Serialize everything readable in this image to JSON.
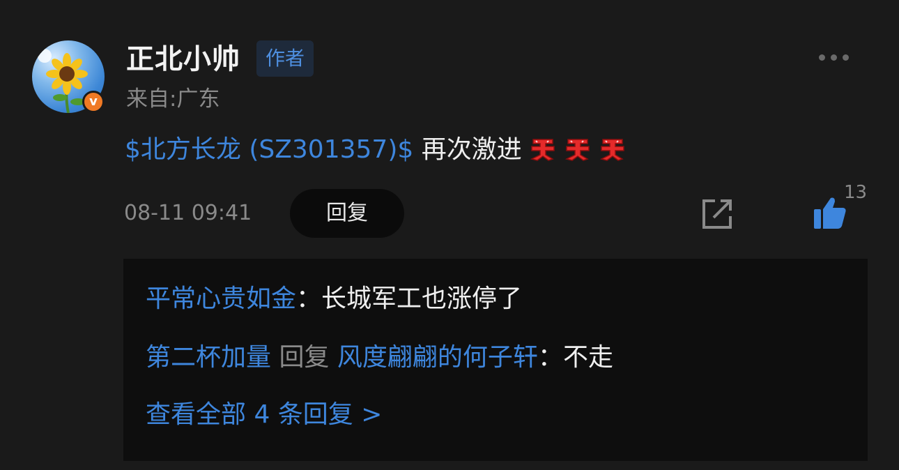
{
  "comment": {
    "username": "正北小帅",
    "author_badge": "作者",
    "location": "来自:广东",
    "stock_tag": "$北方长龙 (SZ301357)$",
    "text": " 再次激进",
    "buy_emoji_name": "buy-emoji",
    "time": "08-11 09:41",
    "reply_label": "回复",
    "like_count": "13"
  },
  "replies": [
    {
      "user": "平常心贵如金",
      "colon": "：",
      "text": "长城军工也涨停了"
    },
    {
      "user": "第二杯加量",
      "reply_word": " 回复 ",
      "target": "风度翩翩的何子轩",
      "colon": "：",
      "text": "不走"
    }
  ],
  "view_all": "查看全部 4 条回复 >",
  "colors": {
    "accent": "#3e86dd",
    "badge_orange": "#f07a25",
    "background": "#1a1a1a"
  }
}
